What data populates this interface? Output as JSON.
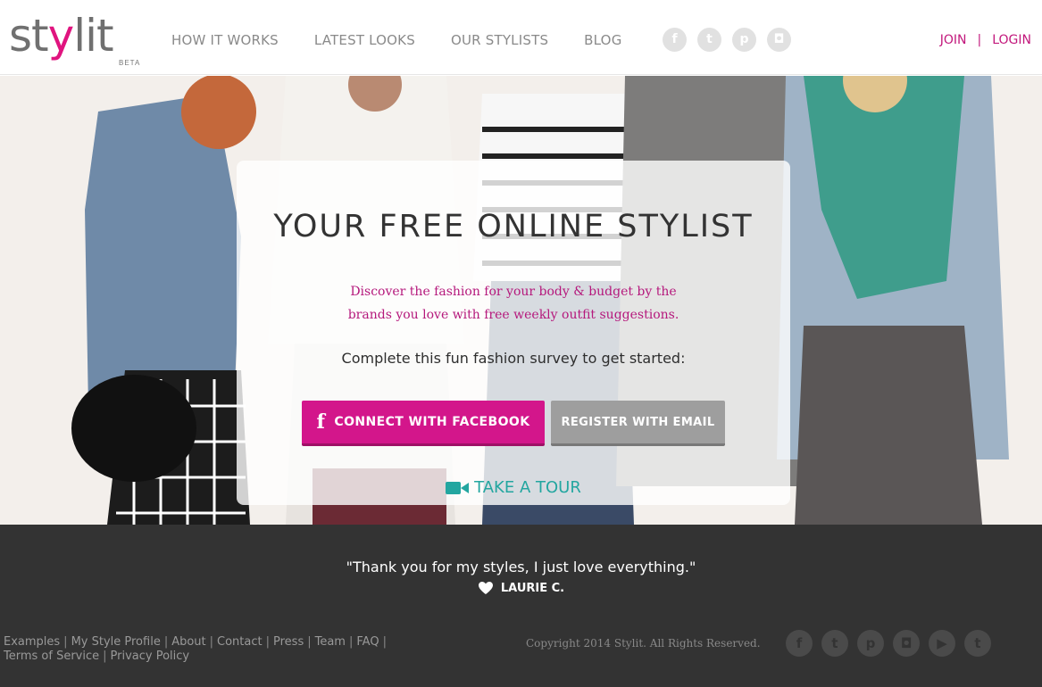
{
  "brand": {
    "logo_text": "stylit",
    "beta_label": "BETA"
  },
  "nav": {
    "items": [
      {
        "label": "HOW IT WORKS"
      },
      {
        "label": "LATEST LOOKS"
      },
      {
        "label": "OUR STYLISTS"
      },
      {
        "label": "BLOG"
      }
    ]
  },
  "social_top": [
    {
      "icon": "facebook-icon",
      "glyph": "f"
    },
    {
      "icon": "twitter-icon",
      "glyph": "t"
    },
    {
      "icon": "pinterest-icon",
      "glyph": "p"
    },
    {
      "icon": "instagram-icon",
      "glyph": "◘"
    }
  ],
  "auth": {
    "join_label": "JOIN",
    "separator": "|",
    "login_label": "LOGIN"
  },
  "hero": {
    "title": "YOUR FREE ONLINE STYLIST",
    "subtitle": "Discover the fashion for your body & budget by the brands you love with free weekly outfit suggestions.",
    "cta_text": "Complete this fun fashion survey to get started:",
    "facebook_button": "CONNECT WITH FACEBOOK",
    "email_button": "REGISTER WITH EMAIL",
    "tour_link": "TAKE A TOUR"
  },
  "testimonial": {
    "quote": "\"Thank you for my styles, I just love everything.\"",
    "author": "LAURIE C."
  },
  "footer": {
    "links": [
      "Examples",
      "My Style Profile",
      "About",
      "Contact",
      "Press",
      "Team",
      "FAQ",
      "Terms of Service",
      "Privacy Policy"
    ],
    "copyright": "Copyright 2014 Stylit. All Rights Reserved."
  },
  "social_bottom": [
    {
      "icon": "facebook-icon",
      "glyph": "f"
    },
    {
      "icon": "twitter-icon",
      "glyph": "t"
    },
    {
      "icon": "pinterest-icon",
      "glyph": "p"
    },
    {
      "icon": "instagram-icon",
      "glyph": "◘"
    },
    {
      "icon": "youtube-icon",
      "glyph": "▶"
    },
    {
      "icon": "tumblr-icon",
      "glyph": "t"
    }
  ],
  "colors": {
    "brand_pink": "#c2187c",
    "facebook_button": "#d3168b",
    "email_button": "#9e9e9e",
    "tour_teal": "#23a6a0",
    "footer_bg": "#333333"
  }
}
